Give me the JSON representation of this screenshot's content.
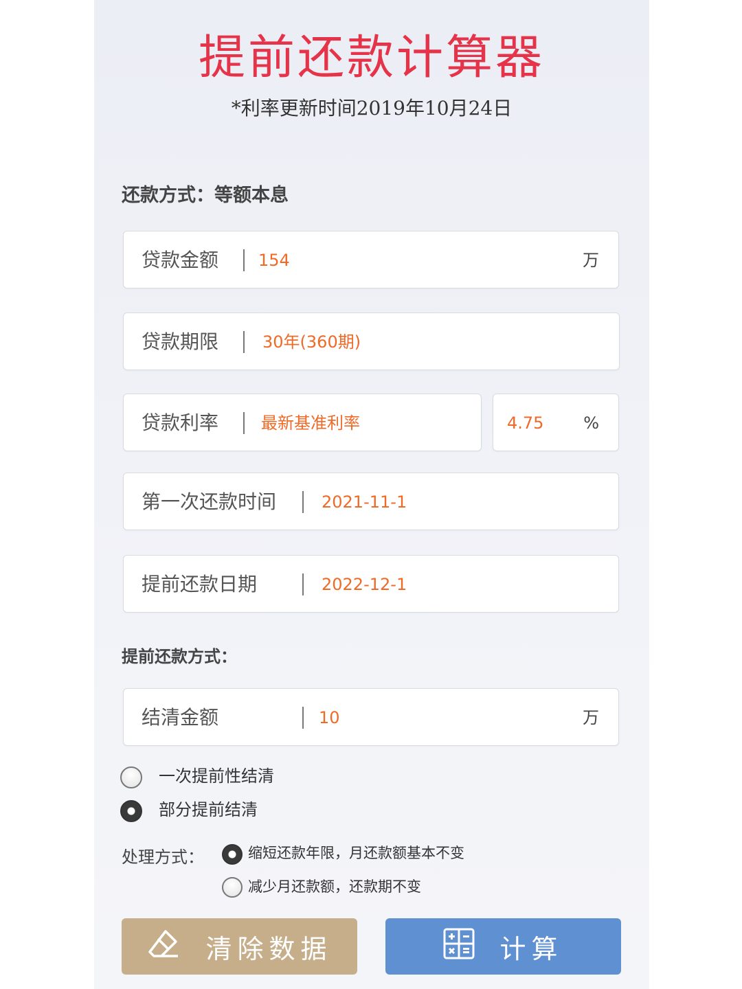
{
  "title": "提前还款计算器",
  "subtitle": "*利率更新时间2019年10月24日",
  "repayment_method": "还款方式：等额本息",
  "fields": {
    "loan_amount": {
      "label": "贷款金额",
      "value": "154",
      "unit": "万"
    },
    "loan_term": {
      "label": "贷款期限",
      "value": "30年(360期)"
    },
    "loan_rate": {
      "label": "贷款利率",
      "value": "最新基准利率",
      "rate_value": "4.75",
      "rate_unit": "%"
    },
    "first_payment": {
      "label": "第一次还款时间",
      "value": "2021-11-1"
    },
    "prepay_date": {
      "label": "提前还款日期",
      "value": "2022-12-1"
    },
    "settle_amount": {
      "label": "结清金额",
      "value": "10",
      "unit": "万"
    }
  },
  "prepay_method_label": "提前还款方式：",
  "prepay_options": [
    {
      "label": "一次提前性结清",
      "selected": false
    },
    {
      "label": "部分提前结清",
      "selected": true
    }
  ],
  "handling_label": "处理方式：",
  "handling_options": [
    {
      "label": "缩短还款年限，月还款额基本不变",
      "selected": true
    },
    {
      "label": "减少月还款额，还款期不变",
      "selected": false
    }
  ],
  "buttons": {
    "clear": "清除数据",
    "calculate": "计算"
  },
  "colors": {
    "title": "#e5344a",
    "value": "#ef6a27",
    "clear_button": "#c7ae8a",
    "calc_button": "#5f90d2"
  }
}
